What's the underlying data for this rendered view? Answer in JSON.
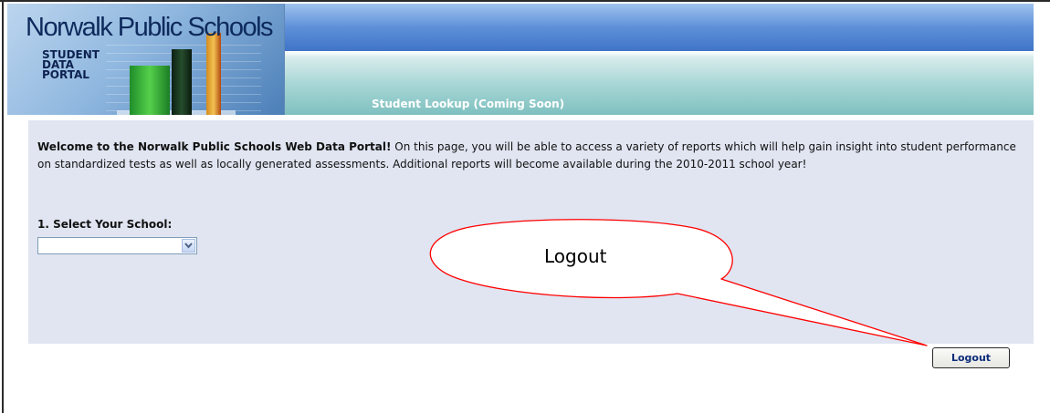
{
  "header": {
    "logo_title": "Norwalk Public Schools",
    "logo_subtitle_lines": [
      "STUDENT",
      "DATA",
      "PORTAL"
    ],
    "nav_item": "Student Lookup (Coming Soon)"
  },
  "main": {
    "welcome_bold": "Welcome to the Norwalk Public Schools Web Data Portal!",
    "welcome_text": " On this page, you will be able to access a variety of reports which will help gain insight into student performance on standardized tests as well as locally generated assessments. Additional reports will become available during the 2010-2011 school year!",
    "select_label": "1. Select Your School:",
    "school_select_value": ""
  },
  "logout_label": "Logout",
  "callout_text": "Logout",
  "icons": {
    "select_arrow": "chevron-down-icon"
  },
  "colors": {
    "header_blue": "#5e90d9",
    "header_teal": "#a9d7d6",
    "content_background": "#e0e5f1",
    "callout_red": "#ff0000"
  }
}
